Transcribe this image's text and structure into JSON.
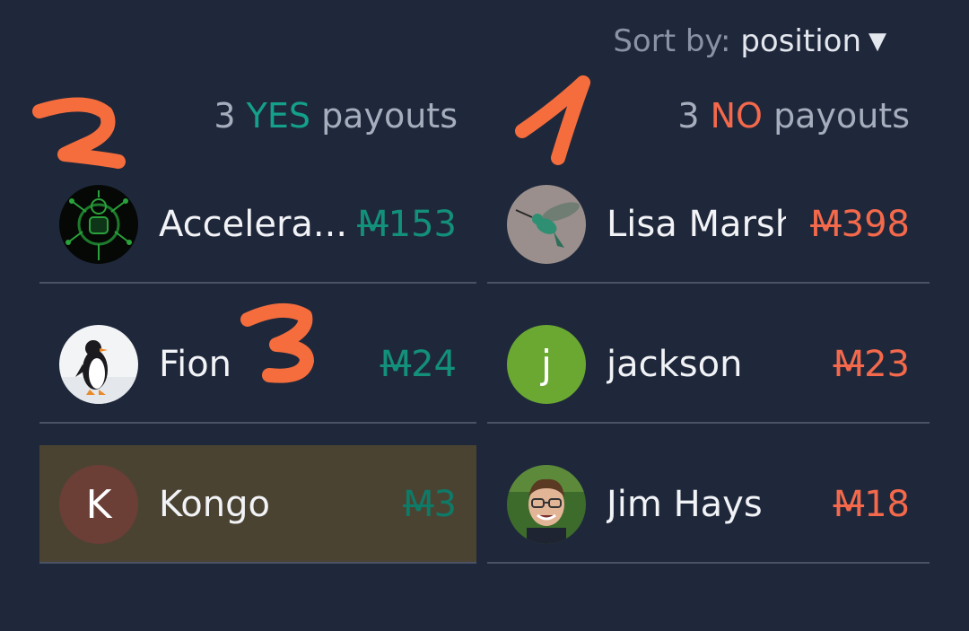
{
  "sort": {
    "label": "Sort by:",
    "value": "position",
    "arrow": "▼"
  },
  "yes_header": {
    "count": "3",
    "outcome": "YES",
    "suffix": "payouts"
  },
  "no_header": {
    "count": "3",
    "outcome": "NO",
    "suffix": "payouts"
  },
  "currency_symbol": "M",
  "yes_rows": [
    {
      "name": "Accelera...",
      "amount": "153",
      "avatar": "circuit-avatar"
    },
    {
      "name": "Fion",
      "amount": "24",
      "avatar": "penguin-avatar"
    },
    {
      "name": "Kongo",
      "amount": "3",
      "avatar_letter": "K",
      "highlighted": true
    }
  ],
  "no_rows": [
    {
      "name": "Lisa Marsh",
      "amount": "398",
      "avatar": "hummingbird-avatar"
    },
    {
      "name": "jackson",
      "amount": "23",
      "avatar_letter": "j"
    },
    {
      "name": "Jim Hays",
      "amount": "18",
      "avatar": "person-avatar"
    }
  ],
  "annotations": {
    "one": "1",
    "two": "2",
    "three": "3"
  },
  "colors": {
    "background": "#1f283b",
    "yes": "#14a08a",
    "no": "#f4694b",
    "highlight": "#4b4332",
    "annotation": "#f56d3c",
    "jackson_avatar": "#6aa832",
    "kongo_avatar": "#6b3e36"
  }
}
